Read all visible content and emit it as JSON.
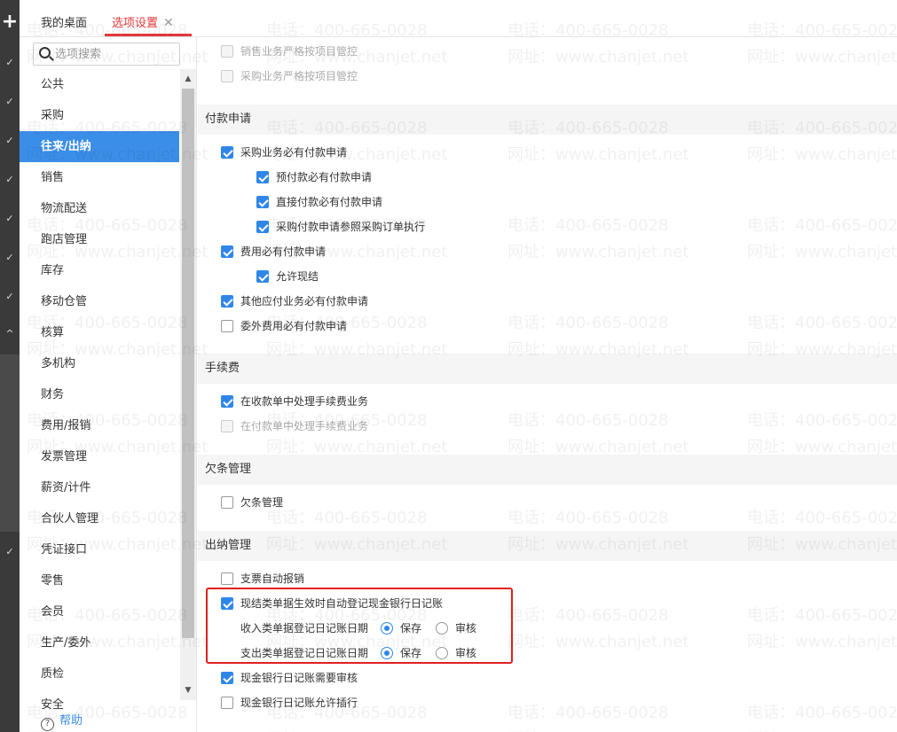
{
  "tabs": {
    "home": "我的桌面",
    "active": "选项设置",
    "close": "✕"
  },
  "search": {
    "placeholder": "选项搜索"
  },
  "nav": {
    "items": [
      "公共",
      "采购",
      "往来/出纳",
      "销售",
      "物流配送",
      "跑店管理",
      "库存",
      "移动仓管",
      "核算",
      "多机构",
      "财务",
      "费用/报销",
      "发票管理",
      "薪资/计件",
      "合伙人管理",
      "凭证接口",
      "零售",
      "会员",
      "生产/委外",
      "质检",
      "安全"
    ],
    "active_index": 2,
    "help": "帮助"
  },
  "content": {
    "top_rows": [
      {
        "label": "销售业务严格按项目管控",
        "checked": false,
        "disabled": true
      },
      {
        "label": "采购业务严格按项目管控",
        "checked": false,
        "disabled": true
      }
    ],
    "sections": {
      "payment": "付款申请",
      "fee": "手续费",
      "debt": "欠条管理",
      "cashier": "出纳管理"
    },
    "payment_rows": [
      {
        "label": "采购业务必有付款申请",
        "checked": true,
        "indent": 0
      },
      {
        "label": "预付款必有付款申请",
        "checked": true,
        "indent": 1
      },
      {
        "label": "直接付款必有付款申请",
        "checked": true,
        "indent": 1
      },
      {
        "label": "采购付款申请参照采购订单执行",
        "checked": true,
        "indent": 1
      },
      {
        "label": "费用必有付款申请",
        "checked": true,
        "indent": 0
      },
      {
        "label": "允许现结",
        "checked": true,
        "indent": 1
      },
      {
        "label": "其他应付业务必有付款申请",
        "checked": true,
        "indent": 0
      },
      {
        "label": "委外费用必有付款申请",
        "checked": false,
        "indent": 0
      }
    ],
    "fee_rows": [
      {
        "label": "在收款单中处理手续费业务",
        "checked": true,
        "disabled": false
      },
      {
        "label": "在付款单中处理手续费业务",
        "checked": false,
        "disabled": true
      }
    ],
    "debt_rows": [
      {
        "label": "欠条管理",
        "checked": false
      }
    ],
    "cashier_rows": [
      {
        "label": "支票自动报销",
        "checked": false
      },
      {
        "label": "现结类单据生效时自动登记现金银行日记账",
        "checked": true
      }
    ],
    "radio_rows": [
      {
        "label": "收入类单据登记日记账日期",
        "opt1": "保存",
        "opt2": "审核",
        "selected": "保存"
      },
      {
        "label": "支出类单据登记日记账日期",
        "opt1": "保存",
        "opt2": "审核",
        "selected": "保存"
      }
    ],
    "bottom_rows": [
      {
        "label": "现金银行日记账需要审核",
        "checked": true
      },
      {
        "label": "现金银行日记账允许插行",
        "checked": false
      }
    ]
  },
  "watermark": {
    "phone": "电话：400-665-0028",
    "site": "网址：www.chanjet.net"
  }
}
